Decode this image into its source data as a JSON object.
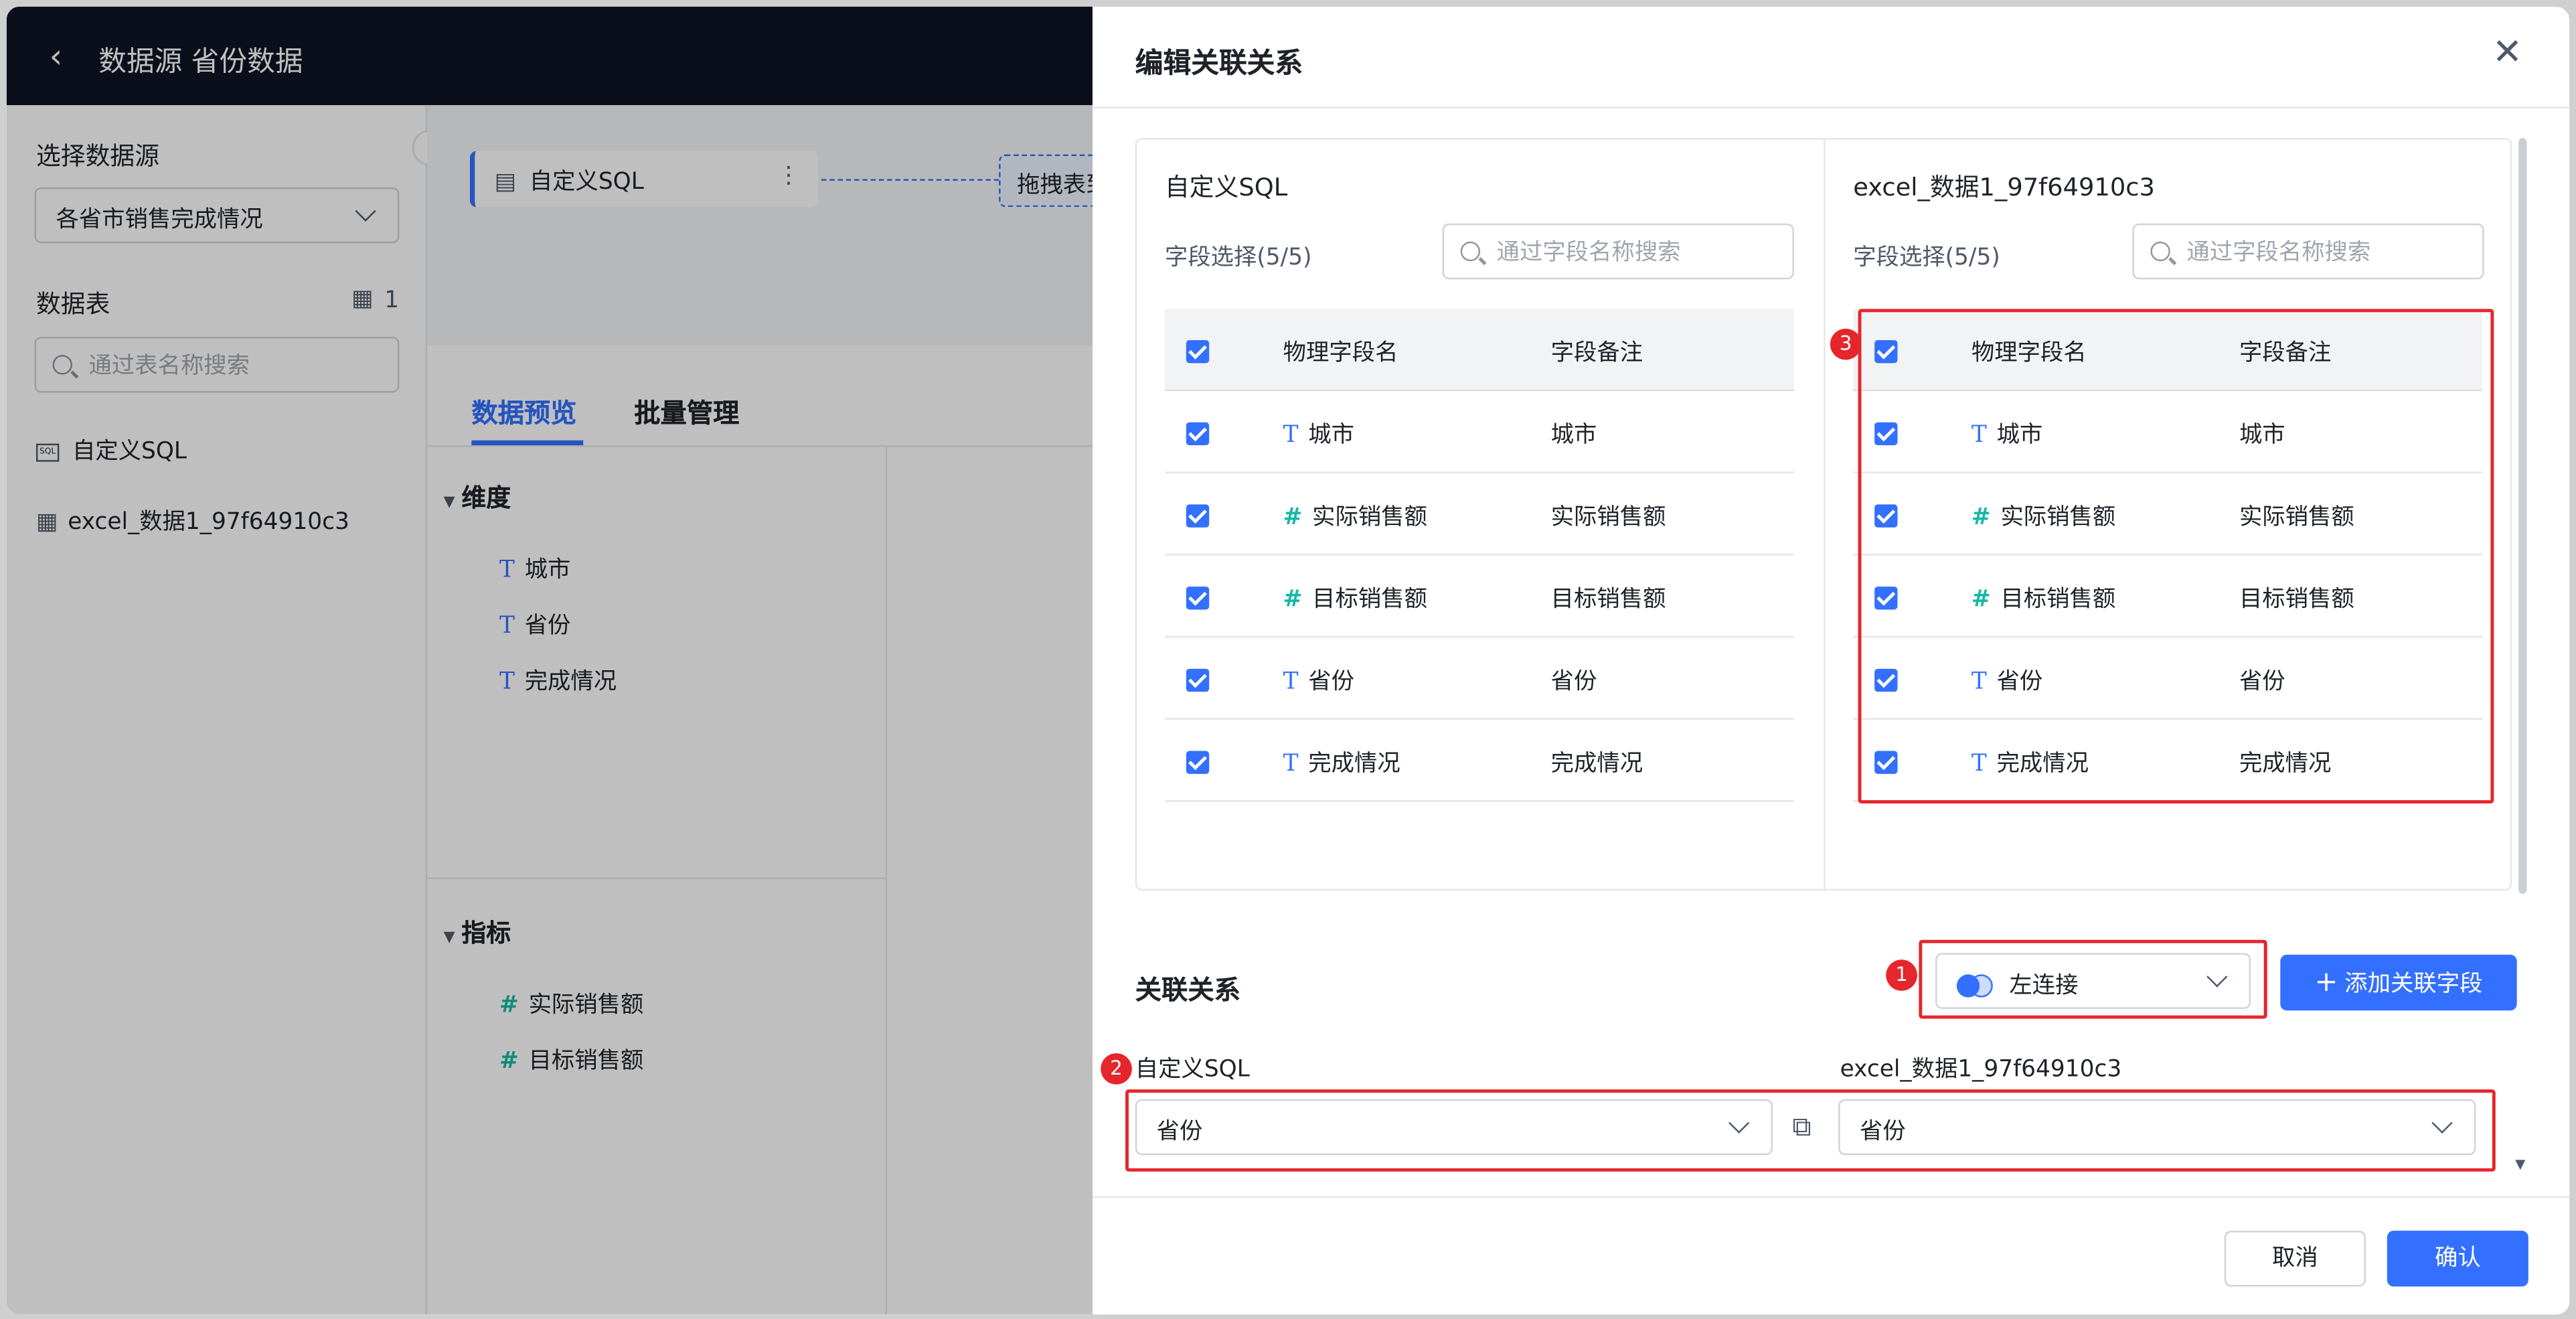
{
  "header": {
    "title": "数据源 省份数据"
  },
  "left_panel": {
    "datasource_label": "选择数据源",
    "datasource_value": "各省市销售完成情况",
    "tables_label": "数据表",
    "tables_count": "1",
    "table_search_placeholder": "通过表名称搜索",
    "tables": [
      "自定义SQL",
      "excel_数据1_97f64910c3"
    ]
  },
  "canvas": {
    "node_label": "自定义SQL",
    "drop_hint": "拖拽表到"
  },
  "tabs": [
    "数据预览",
    "批量管理"
  ],
  "dimensions": {
    "title": "维度",
    "fields": [
      "城市",
      "省份",
      "完成情况"
    ]
  },
  "metrics": {
    "title": "指标",
    "fields": [
      "实际销售额",
      "目标销售额"
    ]
  },
  "drawer": {
    "title": "编辑关联关系",
    "left_table": {
      "name": "自定义SQL",
      "selection": "字段选择(5/5)",
      "search_placeholder": "通过字段名称搜索",
      "col_name": "物理字段名",
      "col_note": "字段备注",
      "rows": [
        {
          "type": "T",
          "name": "城市",
          "note": "城市"
        },
        {
          "type": "#",
          "name": "实际销售额",
          "note": "实际销售额"
        },
        {
          "type": "#",
          "name": "目标销售额",
          "note": "目标销售额"
        },
        {
          "type": "T",
          "name": "省份",
          "note": "省份"
        },
        {
          "type": "T",
          "name": "完成情况",
          "note": "完成情况"
        }
      ]
    },
    "right_table": {
      "name": "excel_数据1_97f64910c3",
      "selection": "字段选择(5/5)",
      "search_placeholder": "通过字段名称搜索",
      "col_name": "物理字段名",
      "col_note": "字段备注",
      "rows": [
        {
          "type": "T",
          "name": "城市",
          "note": "城市"
        },
        {
          "type": "#",
          "name": "实际销售额",
          "note": "实际销售额"
        },
        {
          "type": "#",
          "name": "目标销售额",
          "note": "目标销售额"
        },
        {
          "type": "T",
          "name": "省份",
          "note": "省份"
        },
        {
          "type": "T",
          "name": "完成情况",
          "note": "完成情况"
        }
      ]
    },
    "relation": {
      "title": "关联关系",
      "join_type": "左连接",
      "add_button": "添加关联字段",
      "left_label": "自定义SQL",
      "right_label": "excel_数据1_97f64910c3",
      "left_field": "省份",
      "right_field": "省份"
    },
    "footer": {
      "cancel": "取消",
      "confirm": "确认"
    },
    "badges": [
      "1",
      "2",
      "3"
    ]
  },
  "colors": {
    "accent": "#3370ff",
    "highlight": "#e5262d",
    "metric_icon": "#14b8a6"
  }
}
